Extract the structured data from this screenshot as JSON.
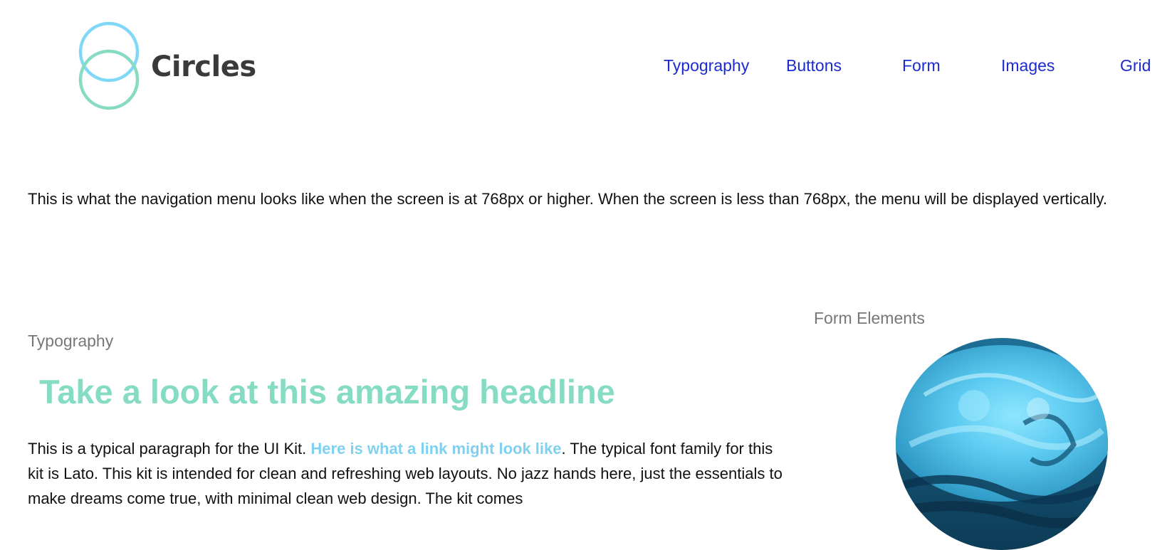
{
  "logo": {
    "name": "Circles"
  },
  "nav": {
    "items": [
      {
        "label": "Typography"
      },
      {
        "label": "Buttons"
      },
      {
        "label": "Form"
      },
      {
        "label": "Images"
      },
      {
        "label": "Grid"
      }
    ]
  },
  "intro": {
    "text": "This is what the navigation menu looks like when the screen is at 768px or higher. When the screen is less than 768px, the menu will be displayed vertically."
  },
  "typography": {
    "label": "Typography",
    "headline": "Take a look at this amazing headline",
    "paragraph_before": "This is a typical paragraph for the UI Kit. ",
    "link_text": "Here is what a link might look like",
    "paragraph_after": ". The typical font family for this kit is Lato. This kit is intended for clean and refreshing web layouts. No jazz hands here, just the essentials to make dreams come true, with minimal clean web design. The kit comes"
  },
  "form": {
    "label": "Form Elements",
    "image_icon": "ocean-wave-image"
  },
  "colors": {
    "nav_link": "#1b2bd1",
    "headline": "#86dbc3",
    "link": "#7fd1ef",
    "logo_ring_top": "#7fd8f5",
    "logo_ring_bottom": "#86dbc3"
  }
}
